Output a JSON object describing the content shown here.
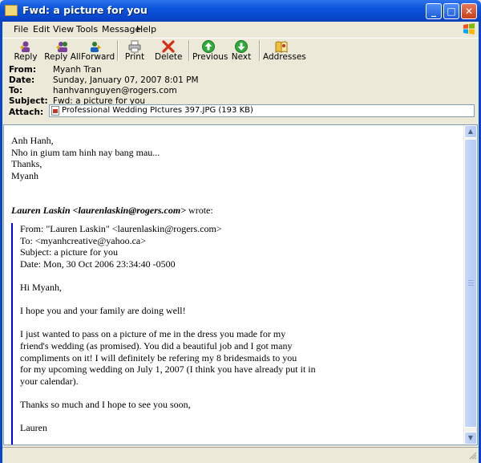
{
  "window": {
    "title": "Fwd: a picture for you"
  },
  "menu": [
    "File",
    "Edit",
    "View",
    "Tools",
    "Message",
    "Help"
  ],
  "toolbar": {
    "reply": "Reply",
    "reply_all": "Reply All",
    "forward": "Forward",
    "print": "Print",
    "delete": "Delete",
    "previous": "Previous",
    "next": "Next",
    "addresses": "Addresses"
  },
  "header": {
    "from_label": "From:",
    "from": "Myanh Tran",
    "date_label": "Date:",
    "date": "Sunday, January 07, 2007 8:01 PM",
    "to_label": "To:",
    "to": "hanhvannguyen@rogers.com",
    "subject_label": "Subject:",
    "subject": "Fwd: a picture for you",
    "attach_label": "Attach:",
    "attachment": "Professional Wedding PIctures 397.JPG (193 KB)"
  },
  "body": {
    "greeting": "Anh Hanh,",
    "line1": "Nho in gium tam hinh nay bang mau...",
    "thanks": "Thanks,",
    "signature": "Myanh",
    "quote_author": "Lauren Laskin <laurenlaskin@rogers.com>",
    "quote_wrote": " wrote:"
  },
  "quoted": {
    "from": "From: \"Lauren Laskin\" <laurenlaskin@rogers.com>",
    "to": "To: <myanhcreative@yahoo.ca>",
    "subject": "Subject: a picture for you",
    "date": "Date: Mon, 30 Oct 2006 23:34:40 -0500",
    "greeting": "Hi Myanh,",
    "p1": "I hope you and your family are doing well!",
    "p2_l1": "I just wanted to pass on a picture of me in the dress you made for my",
    "p2_l2": "friend's wedding (as promised). You did a beautiful job and I got many",
    "p2_l3": "compliments on it! I will definitely be refering my 8 bridesmaids to you",
    "p2_l4": "for my upcoming wedding on July 1, 2007 (I think you have already put it in",
    "p2_l5": "your calendar).",
    "p3": "Thanks so much and I hope to see you soon,",
    "sign": "Lauren"
  }
}
